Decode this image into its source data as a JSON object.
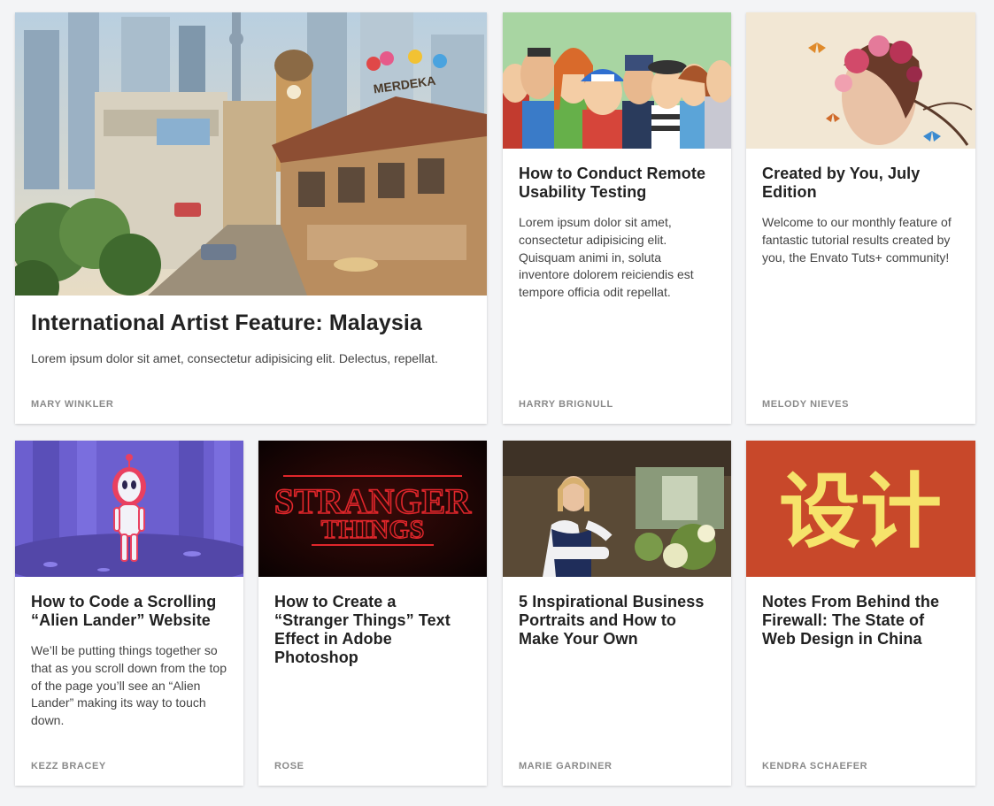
{
  "cards": [
    {
      "title": "International Artist Feature: Malaysia",
      "excerpt": "Lorem ipsum dolor sit amet, consectetur adipisicing elit. Delectus, repellat.",
      "author": "MARY WINKLER",
      "image": "malaysia-cityscape-illustration",
      "image_text": "MERDEKA"
    },
    {
      "title": "How to Conduct Remote Usability Testing",
      "excerpt": "Lorem ipsum dolor sit amet, consectetur adipisicing elit. Quisquam animi in, soluta inventore dolorem reiciendis est tempore officia odit repellat.",
      "author": "HARRY BRIGNULL",
      "image": "cartoon-crowd-illustration"
    },
    {
      "title": "Created by You, July Edition",
      "excerpt": "Welcome to our monthly feature of fantastic tutorial results created by you, the Envato Tuts+ community!",
      "author": "MELODY NIEVES",
      "image": "floral-portrait-butterflies"
    },
    {
      "title": "How to Code a Scrolling “Alien Lander” Website",
      "excerpt": "We’ll be putting things together so that as you scroll down from the top of the page you’ll see an “Alien Lander” making its way to touch down.",
      "author": "KEZZ BRACEY",
      "image": "alien-forest-illustration"
    },
    {
      "title": "How to Create a “Stranger Things” Text Effect in Adobe Photoshop",
      "excerpt": "",
      "author": "ROSE",
      "image": "stranger-things-neon-text",
      "image_text_line1": "STRANGER",
      "image_text_line2": "THINGS"
    },
    {
      "title": "5 Inspirational Business Portraits and How to Make Your Own",
      "excerpt": "",
      "author": "MARIE GARDINER",
      "image": "florist-portrait-photo"
    },
    {
      "title": "Notes From Behind the Firewall: The State of Web Design in China",
      "excerpt": "",
      "author": "KENDRA SCHAEFER",
      "image": "chinese-characters-design",
      "image_text": "设计"
    }
  ],
  "colors": {
    "page_bg": "#f3f4f6",
    "card_bg": "#ffffff",
    "title": "#222222",
    "excerpt": "#444444",
    "author": "#8a8a8a",
    "china_bg": "#c8482a",
    "china_text": "#f6e36b",
    "neon_red": "#e0262b",
    "alien_purple": "#6c5fcf"
  }
}
